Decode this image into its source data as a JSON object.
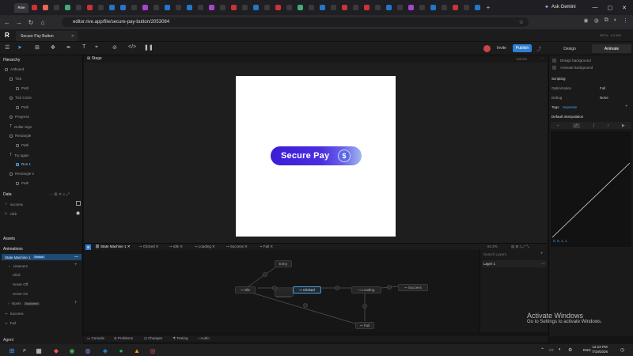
{
  "browser": {
    "tab_active_label": "Rive",
    "ask_gemini": "Ask Gemini",
    "url": "editor.rive.app/file/secure-pay-button/2053084",
    "window_controls": [
      "—",
      "▢",
      "✕"
    ]
  },
  "app": {
    "file_tab": "Secure Pay Button",
    "beta_label": "BETA · 4.0.383",
    "toolbar": {
      "invite": "Invite",
      "publish": "Publish",
      "design": "Design",
      "animate": "Animate"
    },
    "hierarchy": {
      "title": "Hierarchy",
      "items": [
        "Artboard",
        "Tick",
        "Path",
        "Tick Circle",
        "Path",
        "Progress",
        "Dollar Sign",
        "Rectangle",
        "Path",
        "Try again",
        "Run 1",
        "Rectangle 2",
        "Path"
      ]
    },
    "data": {
      "title": "Data",
      "items": [
        "success",
        "click"
      ]
    },
    "assets": {
      "title": "Assets"
    },
    "animations": {
      "title": "Animations",
      "state_machine": "State Machine 1",
      "state_machine_badge": "Default",
      "listeners_label": "Listeners",
      "listeners": [
        "Click",
        "Hover Off",
        "Hover On"
      ],
      "inputs_label": "Inputs",
      "inputs_badge": "Duplicated",
      "timelines": [
        "Success",
        "Fail"
      ]
    },
    "agent": "Agent",
    "stage": {
      "title": "Stage",
      "zoom": "100.0%"
    },
    "button": {
      "label": "Secure Pay",
      "coin_symbol": "$"
    },
    "inspector": {
      "design_background": "Design background",
      "animate_background": "Animate background",
      "scripting": "Scripting",
      "optimization_label": "Optimization",
      "optimization_value": "Full",
      "debug_label": "Debug",
      "debug_value": "None",
      "tags_label": "Tags",
      "tags_value": "Separate",
      "default_interpolation": "Default Interpolation",
      "curve_values": "0, 0, 1, 1"
    },
    "state_machine_tabs": [
      "State Machine 1",
      "Clicked",
      "Idle",
      "Loading",
      "Success",
      "Fail"
    ],
    "state_machine_zoom": "84.3%",
    "nodes": {
      "entry": "Entry",
      "idle": "Idle",
      "clicked": "Clicked",
      "loading": "Loading",
      "success": "Success",
      "fail": "Fail"
    },
    "layers": {
      "search_placeholder": "Search Layers",
      "layer_1": "Layer 1"
    },
    "bottom_bar": [
      "Console",
      "Problems",
      "Changes",
      "Testing",
      "Audio"
    ]
  },
  "watermark": {
    "line1": "Activate Windows",
    "line2": "Go to Settings to activate Windows."
  },
  "taskbar": {
    "lang": "ENG",
    "time": "12:23 PM",
    "date": "7/19/2026"
  },
  "colors": {
    "button_gradient_start": "#3a1dd6",
    "button_gradient_end": "#9fb7f2",
    "publish_accent": "#2f7fd4",
    "selection_accent": "#4a9fe0"
  }
}
